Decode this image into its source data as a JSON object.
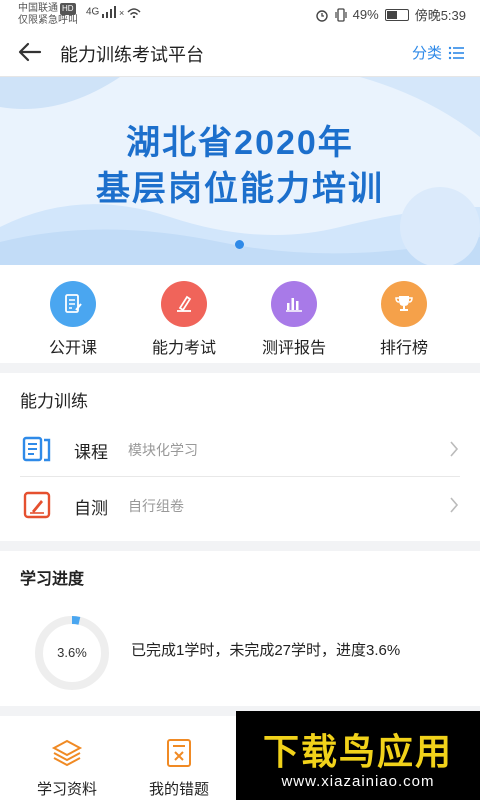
{
  "status_bar": {
    "carrier": "中国联通",
    "hd": "HD",
    "carrier_note": "仅限紧急呼叫",
    "network": "4G",
    "battery": "49%",
    "time": "傍晚5:39"
  },
  "header": {
    "title": "能力训练考试平台",
    "category_label": "分类"
  },
  "banner": {
    "line1": "湖北省2020年",
    "line2": "基层岗位能力培训"
  },
  "quick_nav": [
    {
      "label": "公开课",
      "icon": "document-edit-icon",
      "color": "#4aa6f0"
    },
    {
      "label": "能力考试",
      "icon": "exam-pen-icon",
      "color": "#f0645a"
    },
    {
      "label": "测评报告",
      "icon": "bar-chart-icon",
      "color": "#a87ae8"
    },
    {
      "label": "排行榜",
      "icon": "trophy-icon",
      "color": "#f5a14a"
    }
  ],
  "training": {
    "title": "能力训练",
    "items": [
      {
        "name": "课程",
        "desc": "模块化学习",
        "icon": "course-icon"
      },
      {
        "name": "自测",
        "desc": "自行组卷",
        "icon": "self-test-icon"
      }
    ]
  },
  "progress": {
    "title": "学习进度",
    "percent_text": "3.6%",
    "percent": 3.6,
    "description": "已完成1学时，未完成27学时，进度3.6%"
  },
  "bottom_nav": [
    {
      "label": "学习资料",
      "icon": "layers-icon"
    },
    {
      "label": "我的错题",
      "icon": "wrong-questions-icon"
    }
  ],
  "watermark": {
    "main": "下载鸟应用",
    "url": "www.xiazainiao.com"
  },
  "colors": {
    "accent": "#2f8ae8",
    "banner_text": "#1c6fcc",
    "orange_icon": "#f08a24"
  }
}
